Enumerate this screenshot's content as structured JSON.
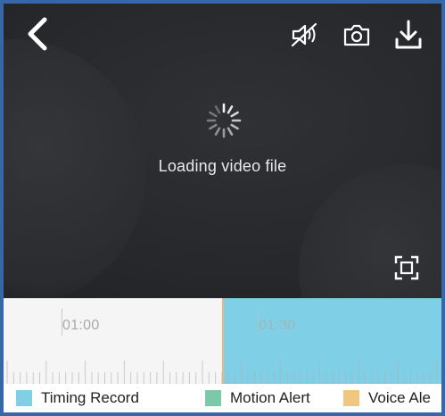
{
  "video": {
    "loading_text": "Loading video file",
    "icons": {
      "back": "chevron-left-icon",
      "mute": "speaker-muted-icon",
      "snapshot": "camera-icon",
      "download": "download-icon",
      "fullscreen": "fullscreen-icon",
      "spinner": "loading-spinner-icon"
    }
  },
  "timeline": {
    "labels": [
      "01:00",
      "01:30"
    ],
    "recorded_color": "#7fd0e6",
    "playhead_color": "#e2b981"
  },
  "legend": {
    "items": [
      {
        "label": "Timing Record",
        "color": "#7fd0e6"
      },
      {
        "label": "Motion Alert",
        "color": "#7cc9a8"
      },
      {
        "label": "Voice Ale",
        "color": "#f0c781"
      }
    ]
  }
}
